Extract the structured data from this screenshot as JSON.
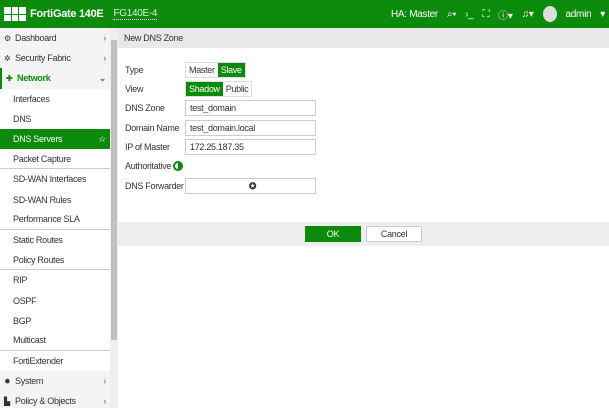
{
  "header": {
    "brand": "FortiGate 140E",
    "serial": "FG140E-4",
    "ha": "HA: Master",
    "user": "admin"
  },
  "sidebar": {
    "items": [
      {
        "label": "Dashboard",
        "icon": "dashboard-icon",
        "glyph": "⚙"
      },
      {
        "label": "Security Fabric",
        "icon": "security-fabric-icon",
        "glyph": "✲"
      },
      {
        "label": "Network",
        "icon": "network-icon",
        "glyph": "✚"
      },
      {
        "label": "Interfaces"
      },
      {
        "label": "DNS"
      },
      {
        "label": "DNS Servers"
      },
      {
        "label": "Packet Capture"
      },
      {
        "label": "SD-WAN Interfaces"
      },
      {
        "label": "SD-WAN Rules"
      },
      {
        "label": "Performance SLA"
      },
      {
        "label": "Static Routes"
      },
      {
        "label": "Policy Routes"
      },
      {
        "label": "RIP"
      },
      {
        "label": "OSPF"
      },
      {
        "label": "BGP"
      },
      {
        "label": "Multicast"
      },
      {
        "label": "FortiExtender"
      },
      {
        "label": "System",
        "icon": "system-icon",
        "glyph": "✹"
      },
      {
        "label": "Policy & Objects",
        "icon": "policy-icon",
        "glyph": "▙"
      }
    ]
  },
  "page": {
    "title": "New DNS Zone"
  },
  "form": {
    "type_label": "Type",
    "type_options": [
      "Master",
      "Slave"
    ],
    "type_selected": "Slave",
    "view_label": "View",
    "view_options": [
      "Shadow",
      "Public"
    ],
    "view_selected": "Shadow",
    "zone_label": "DNS Zone",
    "zone_value": "test_domain",
    "domain_label": "Domain Name",
    "domain_value": "test_domain.local",
    "ip_label": "IP of Master",
    "ip_value": "172.25.187.35",
    "auth_label": "Authoritative",
    "authoritative": true,
    "fwd_label": "DNS Forwarder"
  },
  "footer": {
    "ok": "OK",
    "cancel": "Cancel"
  },
  "colors": {
    "accent": "#0b8a0b"
  }
}
